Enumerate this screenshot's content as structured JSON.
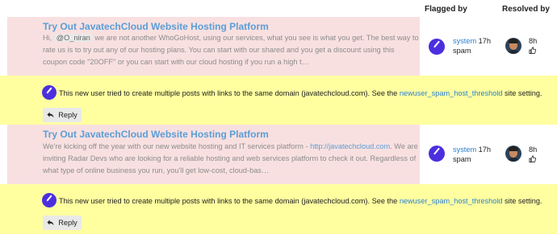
{
  "headers": {
    "flagged_by": "Flagged by",
    "resolved_by": "Resolved by"
  },
  "rows": [
    {
      "title": "Try Out JavatechCloud Website Hosting Platform",
      "body_before": "Hi, ",
      "mention": "@O_niran",
      "body_after": " we are not another WhoGoHost, using our services, what you see is what you get. The best way to rate us is to try out any of our hosting plans. You can start with our shared and you get a discount using this coupon code \"20OFF\" or you can start with our cloud hosting if you run a high t…",
      "flagger": "system",
      "flag_time": "17h",
      "flag_type": "spam",
      "resolved_time": "8h",
      "resolver_icon": "user-avatar",
      "flagger_icon": "system-avatar",
      "thumb_icon": "thumbs-up-icon"
    },
    {
      "title": "Try Out JavatechCloud Website Hosting Platform",
      "body_before": "We're kicking off the year with our new website hosting and IT services platform - ",
      "link": "http://javatechcloud.com",
      "body_after": ". We are inviting Radar Devs who are looking for a reliable hosting and web services platform to check it out. Regardless of what type of online business you run, you'll get low-cost, cloud-bas…",
      "flagger": "system",
      "flag_time": "17h",
      "flag_type": "spam",
      "resolved_time": "8h",
      "resolver_icon": "user-avatar",
      "flagger_icon": "system-avatar",
      "thumb_icon": "thumbs-up-icon"
    }
  ],
  "notice": {
    "text_before": "This new user tried to create multiple posts with links to the same domain (javatechcloud.com). See the ",
    "link": "newuser_spam_host_threshold",
    "text_after": " site setting."
  },
  "reply_label": "Reply",
  "reply_icon": "reply-arrow-icon",
  "colors": {
    "post_bg": "#f9e0e0",
    "notice_bg": "#ffffa0",
    "title": "#5a9ed6",
    "link": "#2a7fcf",
    "system_avatar": "#4b2fdf",
    "button_bg": "#e9e9e9"
  }
}
